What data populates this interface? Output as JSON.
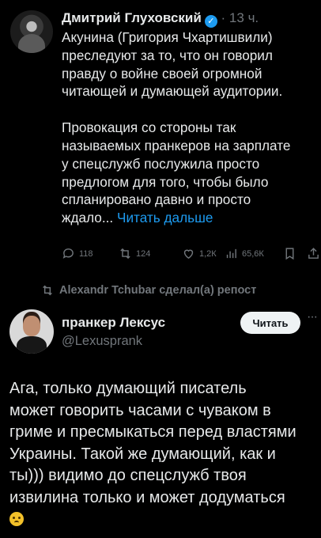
{
  "tweet1": {
    "name": "Дмитрий Глуховский",
    "meta": "· 13 ч.",
    "text_lines_p1": [
      "Акунина (Григория Чхартишвили)",
      "преследуют за то, что он говорил",
      "правду о войне своей огромной",
      "читающей и думающей аудитории."
    ],
    "text_lines_p2": [
      "Провокация со стороны так",
      "называемых пранкеров на зарплате",
      "у спецслужб послужила просто",
      "предлогом для того, чтобы было",
      "спланировано давно и просто"
    ],
    "last_line_prefix": "ждало...",
    "read_more": "Читать дальше",
    "stats": {
      "replies": "118",
      "reposts": "124",
      "likes": "1,2К",
      "views": "65,6К"
    }
  },
  "repost_label": "Alexandr Tchubar сделал(а) репост",
  "tweet2": {
    "name": "пранкер Лексус",
    "handle": "@Lexusprank",
    "follow_label": "Читать",
    "more": "···",
    "text_lines": [
      "Ага, только думающий писатель",
      "может говорить часами с чуваком  в",
      "гриме и пресмыкаться перед властями",
      "Украины. Такой же думающий, как и",
      "ты))) видимо до спецслужб твоя",
      "извилина только и может додуматься"
    ]
  },
  "icons": {
    "verified": "verified-badge-icon",
    "emoji": "pleading-face-emoji"
  },
  "colors": {
    "background": "#000000",
    "text": "#e7e9ea",
    "muted": "#71767b",
    "accent": "#1d9bf0"
  }
}
